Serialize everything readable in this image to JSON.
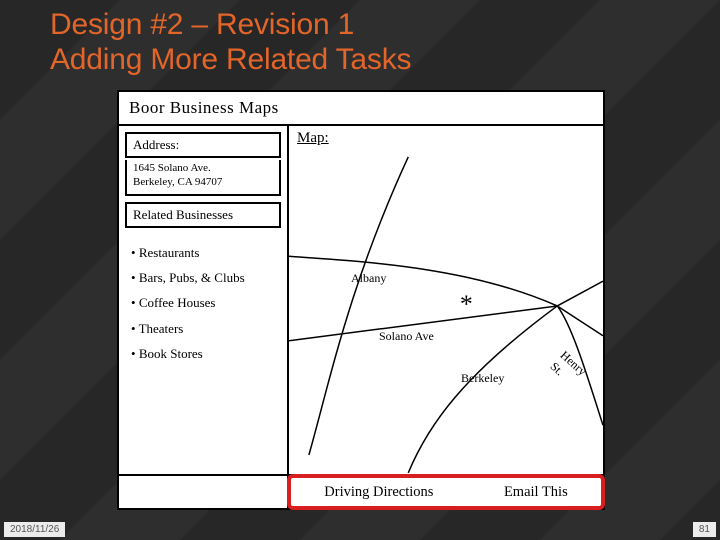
{
  "title": {
    "line1": "Design #2 – Revision 1",
    "line2": "Adding More Related Tasks"
  },
  "sketch": {
    "product_title": "Boor Business Maps",
    "address_label": "Address:",
    "address_value": "1645 Solano Ave.\nBerkeley, CA 94707",
    "related_label": "Related Businesses",
    "related_items": [
      "Restaurants",
      "Bars, Pubs, & Clubs",
      "Coffee Houses",
      "Theaters",
      "Book Stores"
    ],
    "map_label": "Map:",
    "map_places": {
      "albany": "Albany",
      "solano": "Solano Ave",
      "berkeley": "Berkeley",
      "henry": "Henry St."
    },
    "footer_links": {
      "directions": "Driving Directions",
      "email": "Email This"
    }
  },
  "slide_meta": {
    "date": "2018/11/26",
    "page": "81"
  }
}
